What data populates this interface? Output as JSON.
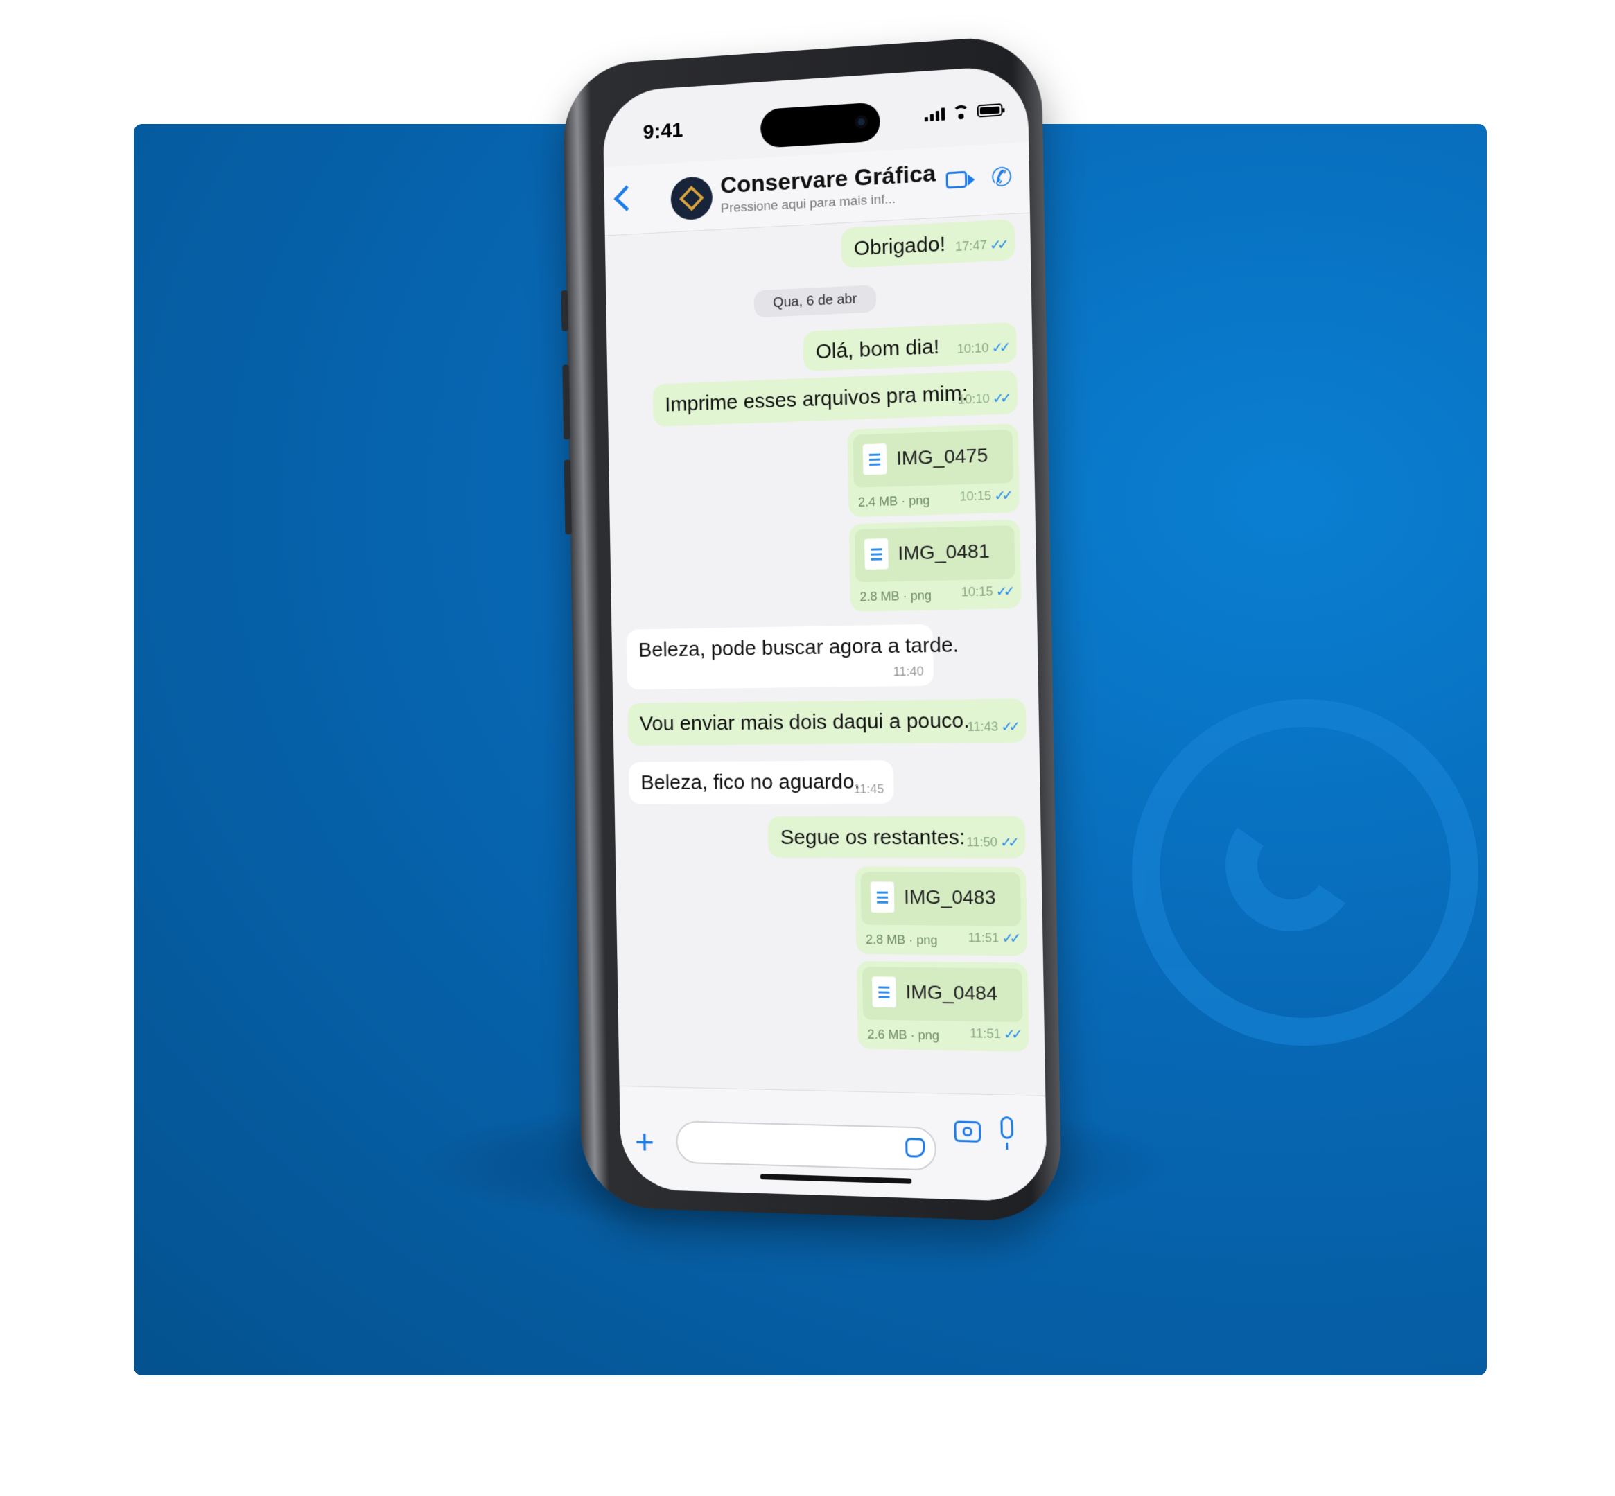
{
  "status_bar": {
    "time": "9:41"
  },
  "header": {
    "contact_name": "Conservare Gráfica",
    "contact_subtitle": "Pressione aqui para mais inf...",
    "icons": [
      "back-chevron-icon",
      "video-call-icon",
      "phone-call-icon"
    ]
  },
  "messages": [
    {
      "type": "text",
      "direction": "out",
      "text": "Obrigado!",
      "time": "17:47",
      "read": true
    },
    {
      "type": "date",
      "text": "Qua, 6 de abr"
    },
    {
      "type": "text",
      "direction": "out",
      "text": "Olá, bom dia!",
      "time": "10:10",
      "read": true
    },
    {
      "type": "text",
      "direction": "out",
      "text": "Imprime esses arquivos pra mim:",
      "time": "10:10",
      "read": true
    },
    {
      "type": "file",
      "direction": "out",
      "name": "IMG_0475",
      "size": "2.4 MB",
      "ext": "png",
      "time": "10:15",
      "read": true
    },
    {
      "type": "file",
      "direction": "out",
      "name": "IMG_0481",
      "size": "2.8 MB",
      "ext": "png",
      "time": "10:15",
      "read": true
    },
    {
      "type": "text",
      "direction": "in",
      "text": "Beleza, pode buscar agora a tarde.",
      "time": "11:40"
    },
    {
      "type": "text",
      "direction": "out",
      "text": "Vou enviar mais dois daqui a pouco.",
      "time": "11:43",
      "read": true
    },
    {
      "type": "text",
      "direction": "in",
      "text": "Beleza, fico no aguardo.",
      "time": "11:45"
    },
    {
      "type": "text",
      "direction": "out",
      "text": "Segue os restantes:",
      "time": "11:50",
      "read": true
    },
    {
      "type": "file",
      "direction": "out",
      "name": "IMG_0483",
      "size": "2.8 MB",
      "ext": "png",
      "time": "11:51",
      "read": true
    },
    {
      "type": "file",
      "direction": "out",
      "name": "IMG_0484",
      "size": "2.6 MB",
      "ext": "png",
      "time": "11:51",
      "read": true
    }
  ],
  "composer": {
    "input_value": "",
    "icons": [
      "plus-icon",
      "sticker-icon",
      "camera-icon",
      "microphone-icon"
    ]
  },
  "colors": {
    "accent": "#1e7ce6",
    "outgoing_bubble": "#e1f5d2",
    "incoming_bubble": "#ffffff",
    "backdrop": "#0767b4"
  }
}
